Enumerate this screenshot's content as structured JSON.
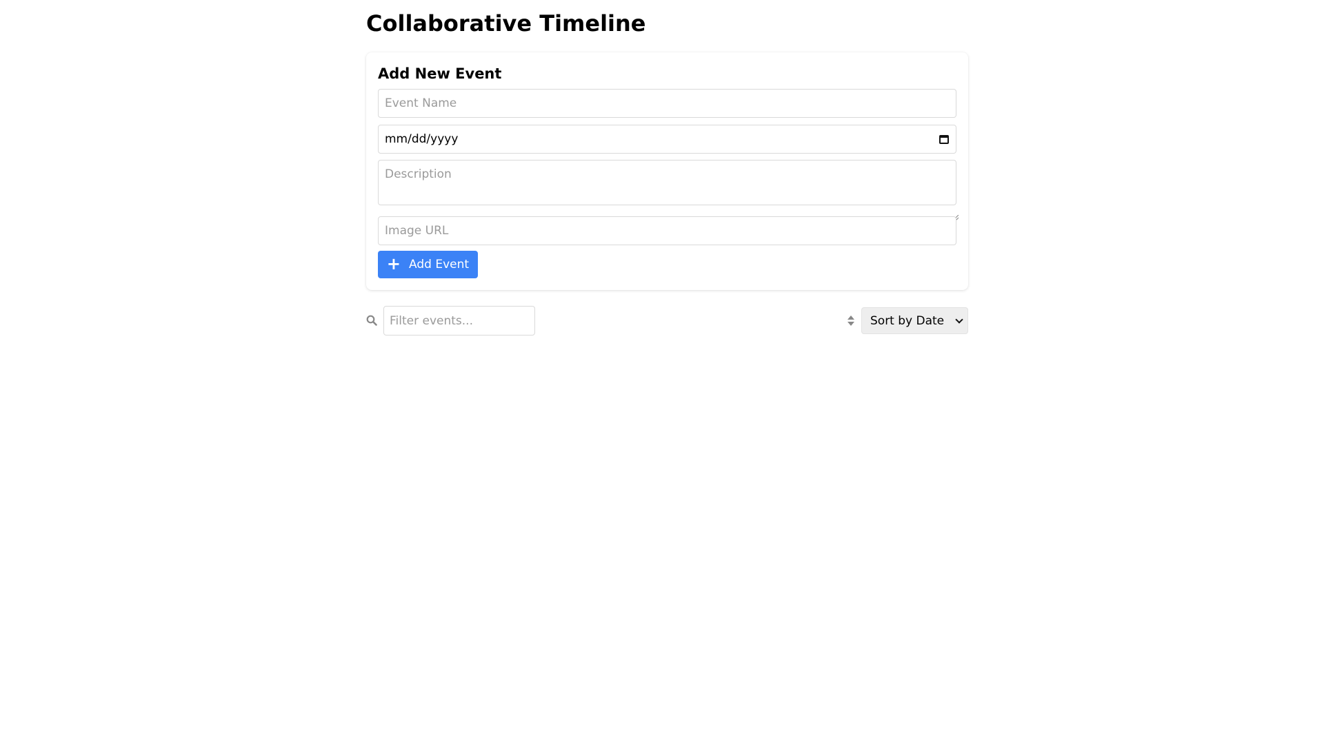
{
  "page": {
    "title": "Collaborative Timeline"
  },
  "form": {
    "title": "Add New Event",
    "event_name_placeholder": "Event Name",
    "date_placeholder": "mm/dd/yyyy",
    "description_placeholder": "Description",
    "image_url_placeholder": "Image URL",
    "add_button_label": "Add Event",
    "add_button_icon": "plus-icon"
  },
  "toolbar": {
    "search_icon": "search-icon",
    "filter_placeholder": "Filter events...",
    "sort_icon": "sort-icon",
    "sort_selected": "Sort by Date"
  },
  "colors": {
    "accent": "#3b82f6",
    "select_background": "#eeeeee",
    "border": "#d9d9d9"
  }
}
